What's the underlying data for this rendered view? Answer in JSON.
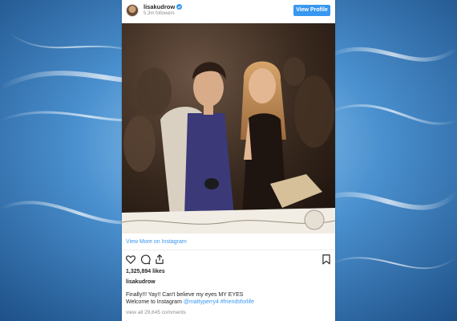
{
  "colors": {
    "background_blue": "#2a6aa6",
    "instagram_blue": "#3897f0",
    "text_dark": "#262626",
    "text_muted": "#8e8e8e"
  },
  "post": {
    "username": "lisakudrow",
    "followers": "5.3m followers",
    "view_profile_label": "View Profile",
    "view_more_label": "View More on Instagram",
    "likes": "1,325,894 likes",
    "caption_username": "lisakudrow",
    "caption_line1": "Finally!!! Yay!! Can't believe my eyes MY EYES",
    "caption_line2_text": "Welcome to Instagram ",
    "caption_mention": "@mattyperry4",
    "caption_hashtag": "#friendsforlife",
    "comments": "view all 29,645 comments"
  },
  "icons": {
    "verified": "verified-badge-icon",
    "like": "heart-icon",
    "comment": "comment-icon",
    "share": "share-icon",
    "save": "bookmark-icon"
  }
}
